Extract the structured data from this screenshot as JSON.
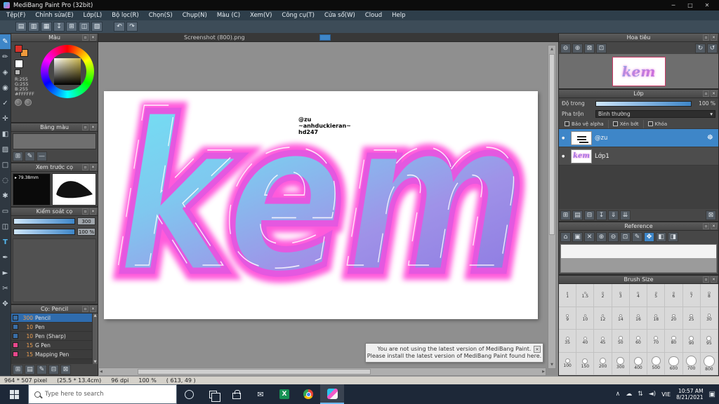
{
  "titlebar": {
    "title": "MediBang Paint Pro (32bit)"
  },
  "menubar": {
    "items": [
      "Tệp(F)",
      "Chỉnh sửa(E)",
      "Lớp(L)",
      "Bộ lọc(R)",
      "Chọn(S)",
      "Chụp(N)",
      "Màu (C)",
      "Xem(V)",
      "Công cụ(T)",
      "Cửa sổ(W)",
      "Cloud",
      "Help"
    ]
  },
  "toolbar": {
    "buttons": [
      "new-canvas-icon",
      "open-icon",
      "save-icon",
      "export-icon",
      "grid-icon",
      "snap-icon",
      "material-icon"
    ],
    "history": [
      "undo-icon",
      "redo-icon"
    ]
  },
  "toolstrip": {
    "tools": [
      {
        "name": "brush-tool",
        "active": true
      },
      {
        "name": "pencil-tool"
      },
      {
        "name": "eraser-tool"
      },
      {
        "name": "finger-tool"
      },
      {
        "name": "filter-tool"
      },
      {
        "name": "move-tool"
      },
      {
        "name": "fill-tool"
      },
      {
        "name": "gradient-tool"
      },
      {
        "name": "select-tool"
      },
      {
        "name": "lasso-tool"
      },
      {
        "name": "magic-wand-tool"
      },
      {
        "name": "shape-brush-tool"
      },
      {
        "name": "divide-tool"
      },
      {
        "name": "text-tool"
      },
      {
        "name": "eyedropper-tool"
      },
      {
        "name": "operation-tool"
      },
      {
        "name": "slice-tool"
      },
      {
        "name": "hand-tool"
      }
    ]
  },
  "color_panel": {
    "title": "Màu",
    "rgb_lines": [
      "R:255",
      "G:255",
      "B:255"
    ],
    "hex": "#FFFFFF"
  },
  "palette_panel": {
    "title": "Bảng màu",
    "toolbar": [
      "add-swatch-icon",
      "edit-swatch-icon",
      "remove-swatch-icon"
    ]
  },
  "brush_preview_panel": {
    "title": "Xem trước cọ",
    "size_label": "79.38mm"
  },
  "brush_control_panel": {
    "title": "Kiểm soát cọ",
    "size_value": "300",
    "opacity_value": "100 %"
  },
  "brush_list_panel": {
    "title": "Cọ: Pencil",
    "brushes": [
      {
        "size": "300",
        "name": "Pencil",
        "selected": true,
        "chip": "#3a6ea5"
      },
      {
        "size": "10",
        "name": "Pen",
        "chip": "#3a6ea5"
      },
      {
        "size": "10",
        "name": "Pen (Sharp)",
        "chip": "#3a6ea5"
      },
      {
        "size": "15",
        "name": "G Pen",
        "chip": "#e8488b"
      },
      {
        "size": "15",
        "name": "Mapping Pen",
        "chip": "#e8488b"
      }
    ],
    "toolbar": [
      "add-brush-icon",
      "brush-folder-icon",
      "brush-settings-icon",
      "duplicate-brush-icon",
      "delete-brush-icon"
    ]
  },
  "canvas": {
    "tab_label": "Screenshot (800).png",
    "artwork_word": "kem",
    "watermark_lines": [
      "@zu",
      "~anhduckieran~",
      "hd247"
    ]
  },
  "navigator": {
    "title": "Hoa tiêu",
    "tools": [
      "zoom-out-icon",
      "zoom-in-icon",
      "fit-window-icon",
      "actual-size-icon",
      "rotate-view-icon",
      "reset-rotation-icon"
    ]
  },
  "layer_panel": {
    "title": "Lớp",
    "opacity_label": "Độ trong",
    "opacity_value": "100 %",
    "blend_label": "Pha trộn",
    "blend_value": "Bình thường",
    "checkboxes": [
      "Bảo vệ alpha",
      "Xén bớt",
      "Khóa"
    ],
    "layers": [
      {
        "name": "@zu",
        "selected": true,
        "thumb": "text"
      },
      {
        "name": "Lớp1",
        "selected": false,
        "thumb": "kem"
      }
    ],
    "toolbar": [
      "add-layer-icon",
      "add-folder-icon",
      "duplicate-layer-icon",
      "transfer-layer-icon",
      "apply-layer-icon",
      "merge-layer-icon",
      "delete-layer-icon"
    ]
  },
  "reference_panel": {
    "title": "Reference",
    "tools": [
      "home-icon",
      "image-icon",
      "clear-icon",
      "zoom-in-icon",
      "zoom-out-icon",
      "actual-size-icon",
      "pen-icon",
      {
        "name": "pan-hand-icon",
        "active": true
      },
      "crop-icon",
      "pin-icon"
    ]
  },
  "brush_size_panel": {
    "title": "Brush Size",
    "sizes": [
      "1",
      "1.5",
      "2",
      "3",
      "4",
      "5",
      "6",
      "7",
      "8",
      "9",
      "10",
      "12",
      "14",
      "16",
      "18",
      "20",
      "25",
      "30",
      "35",
      "40",
      "45",
      "50",
      "60",
      "70",
      "80",
      "90",
      "95",
      "100",
      "150",
      "200",
      "300",
      "400",
      "500",
      "600",
      "700",
      "800"
    ]
  },
  "statusbar": {
    "size": "964 * 507 pixel",
    "dimensions": "(25.5 * 13.4cm)",
    "dpi": "96 dpi",
    "zoom": "100 %",
    "coords": "( 613, 49 )"
  },
  "notification": {
    "line1": "You are not using the latest version of MediBang Paint.",
    "line2": "Please install the latest version of MediBang Paint found here."
  },
  "taskbar": {
    "search_placeholder": "Type here to search",
    "language": "VIE",
    "time": "10:57 AM",
    "date": "8/21/2021",
    "tray_icons": [
      "tray-expand-icon",
      "cloud-icon",
      "network-icon",
      "volume-icon"
    ]
  },
  "colors": {
    "accent_blue": "#3e86c8",
    "artwork_pink": "#ff49d8",
    "artwork_edge_pink": "#e458e0",
    "artwork_cyan": "#6fe6f4",
    "artwork_mid": "#7fc8ef",
    "artwork_violet": "#9f92e8",
    "artwork_purple": "#8f7ce2",
    "thumbnail_border": "#cc3a66"
  }
}
